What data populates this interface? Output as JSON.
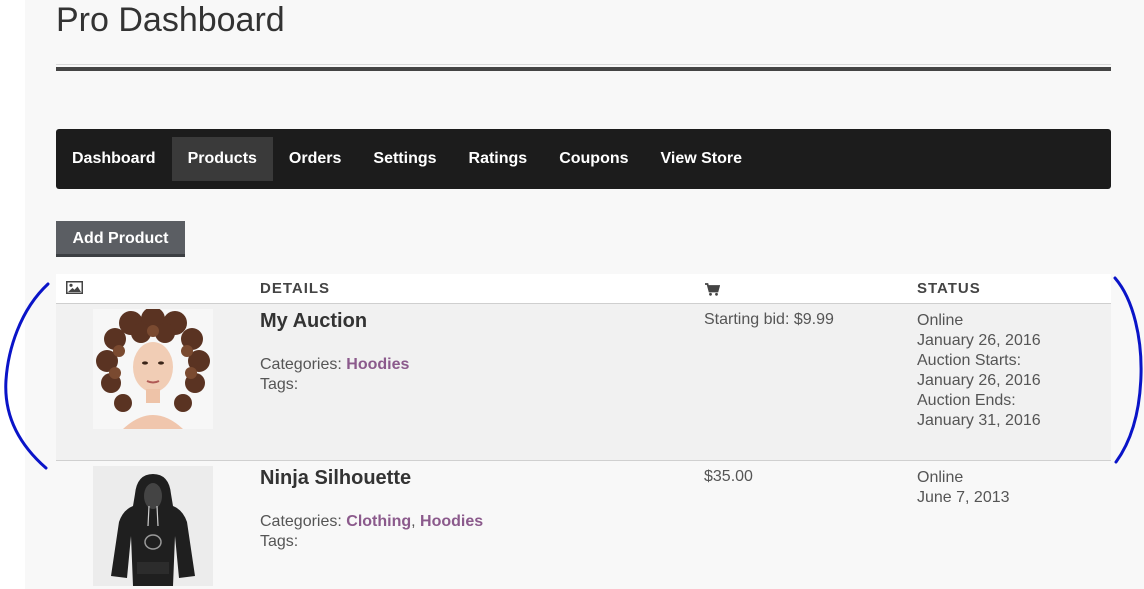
{
  "page": {
    "title": "Pro Dashboard"
  },
  "nav": {
    "items": [
      {
        "label": "Dashboard",
        "active": false
      },
      {
        "label": "Products",
        "active": true
      },
      {
        "label": "Orders",
        "active": false
      },
      {
        "label": "Settings",
        "active": false
      },
      {
        "label": "Ratings",
        "active": false
      },
      {
        "label": "Coupons",
        "active": false
      },
      {
        "label": "View Store",
        "active": false
      }
    ]
  },
  "actions": {
    "add_product_label": "Add Product"
  },
  "table": {
    "headers": {
      "image_icon": "image-icon",
      "details": "DETAILS",
      "price_icon": "cart-icon",
      "status": "STATUS"
    },
    "rows": [
      {
        "name": "My Auction",
        "categories_label": "Categories:",
        "categories": [
          "Hoodies"
        ],
        "tags_label": "Tags:",
        "price": "Starting bid: $9.99",
        "status_lines": [
          "Online",
          "January 26, 2016",
          "Auction Starts:",
          "January 26, 2016",
          "Auction Ends:",
          "January 31, 2016"
        ],
        "thumbnail": "woman-with-curly-hair-photo"
      },
      {
        "name": "Ninja Silhouette",
        "categories_label": "Categories:",
        "categories": [
          "Clothing",
          "Hoodies"
        ],
        "tags_label": "Tags:",
        "price": "$35.00",
        "status_lines": [
          "Online",
          "June 7, 2013"
        ],
        "thumbnail": "black-hoodie-photo"
      }
    ]
  },
  "colors": {
    "nav_bg": "#1c1c1c",
    "link": "#8b5a8c",
    "button_bg": "#5b5e63",
    "annotation": "#0a14c8"
  }
}
